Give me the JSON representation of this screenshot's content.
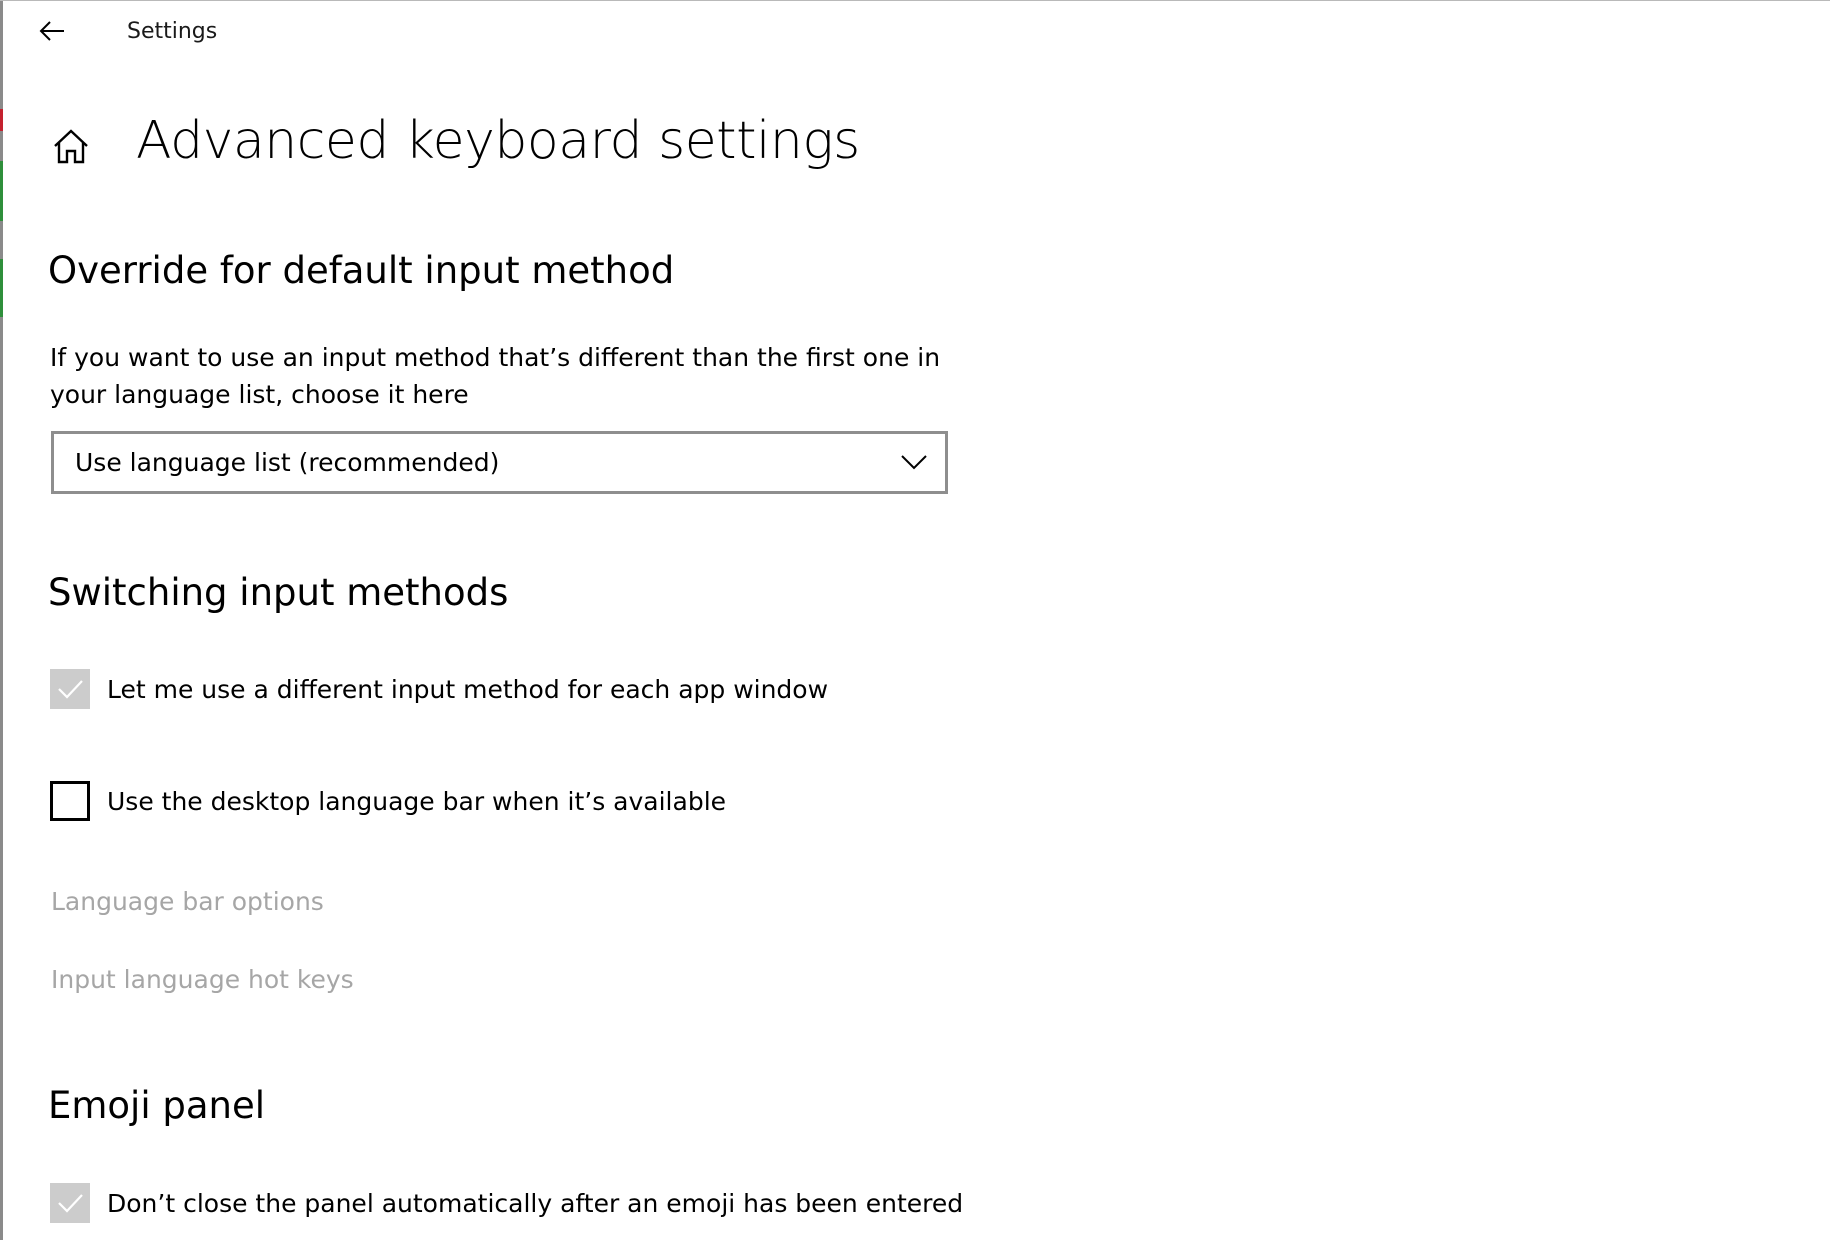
{
  "app": {
    "title": "Settings"
  },
  "header": {
    "title": "Advanced keyboard settings"
  },
  "override_section": {
    "title": "Override for default input method",
    "description": "If you want to use an input method that’s different than the first one in your language list, choose it here",
    "dropdown": {
      "selected": "Use language list (recommended)"
    }
  },
  "switching_section": {
    "title": "Switching input methods",
    "checkboxes": [
      {
        "label": "Let me use a different input method for each app window",
        "checked": true,
        "enabled": false
      },
      {
        "label": "Use the desktop language bar when it’s available",
        "checked": false,
        "enabled": true
      }
    ],
    "links": [
      {
        "label": "Language bar options",
        "enabled": false
      },
      {
        "label": "Input language hot keys",
        "enabled": false
      }
    ]
  },
  "emoji_section": {
    "title": "Emoji panel",
    "checkboxes": [
      {
        "label": "Don’t close the panel automatically after an emoji has been entered",
        "checked": true,
        "enabled": false
      }
    ]
  },
  "icons": {
    "back": "back-arrow-icon",
    "home": "home-icon",
    "dropdown": "chevron-down-icon",
    "check": "checkmark-icon"
  },
  "colors": {
    "disabled_text": "#a6a6a6",
    "disabled_checkbox": "#cccccc",
    "dropdown_border": "#8e8e8e"
  }
}
